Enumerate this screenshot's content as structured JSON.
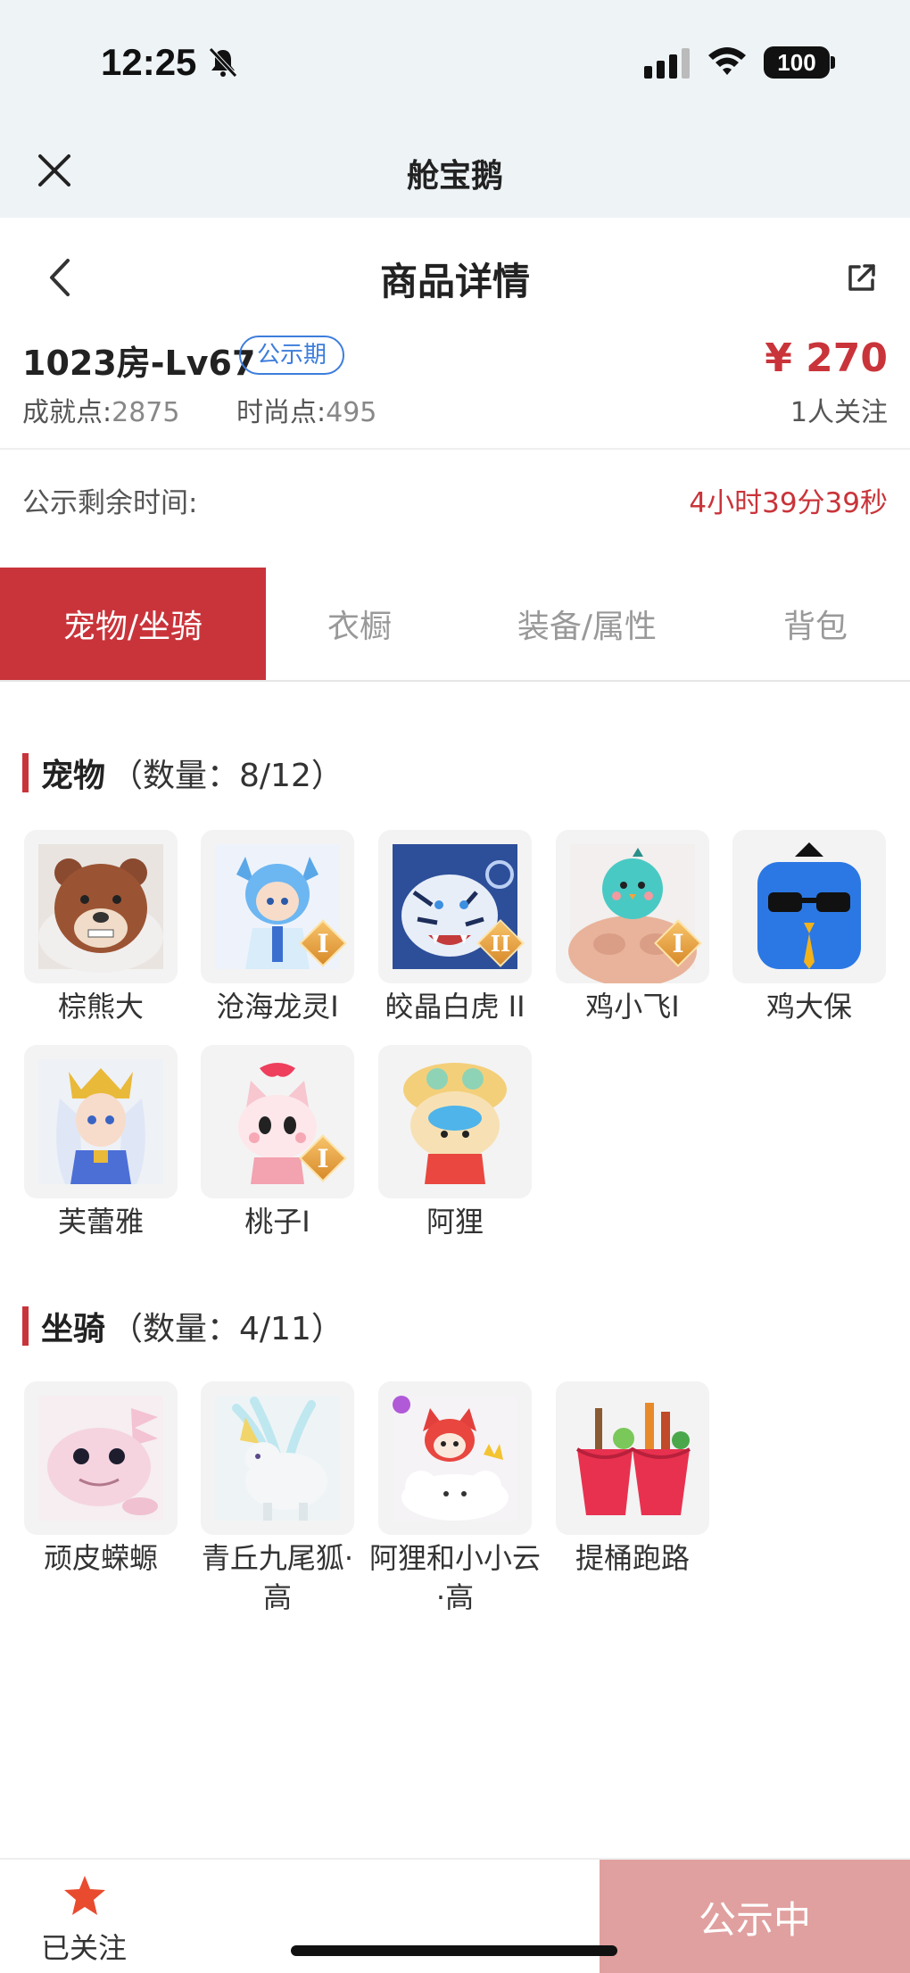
{
  "status_bar": {
    "time": "12:25",
    "battery": "100"
  },
  "app_bar": {
    "title": "舱宝鹅"
  },
  "header": {
    "title": "商品详情"
  },
  "product": {
    "title": "1023房-Lv67",
    "badge": "公示期",
    "price": "¥ 270",
    "achievement_label": "成就点:",
    "achievement_value": "2875",
    "fashion_label": "时尚点:",
    "fashion_value": "495",
    "followers": "1人关注"
  },
  "remaining": {
    "label": "公示剩余时间:",
    "value": "4小时39分39秒"
  },
  "tabs": [
    {
      "label": "宠物/坐骑",
      "active": true
    },
    {
      "label": "衣橱",
      "active": false
    },
    {
      "label": "装备/属性",
      "active": false
    },
    {
      "label": "背包",
      "active": false
    }
  ],
  "pets": {
    "title": "宠物",
    "count": "（数量：8/12）",
    "items": [
      {
        "name": "棕熊大",
        "icon": "brown-bear-icon"
      },
      {
        "name": "沧海龙灵I",
        "icon": "dragon-spirit-icon",
        "rank": "I"
      },
      {
        "name": "皎晶白虎 II",
        "icon": "white-tiger-icon",
        "rank": "II"
      },
      {
        "name": "鸡小飞I",
        "icon": "chick-icon",
        "rank": "I"
      },
      {
        "name": "鸡大保",
        "icon": "chicken-sunglasses-icon"
      },
      {
        "name": "芙蕾雅",
        "icon": "freya-icon"
      },
      {
        "name": "桃子I",
        "icon": "peach-fox-icon",
        "rank": "I"
      },
      {
        "name": "阿狸",
        "icon": "ali-fox-icon"
      }
    ]
  },
  "mounts": {
    "title": "坐骑",
    "count": "（数量：4/11）",
    "items": [
      {
        "name": "顽皮蝾螈",
        "icon": "axolotl-icon"
      },
      {
        "name": "青丘九尾狐·高",
        "icon": "nine-tail-fox-icon"
      },
      {
        "name": "阿狸和小小云·高",
        "icon": "ali-cloud-icon"
      },
      {
        "name": "提桶跑路",
        "icon": "bucket-icon"
      }
    ]
  },
  "bottom": {
    "follow_label": "已关注",
    "action_label": "公示中"
  },
  "colors": {
    "accent": "#c9343a",
    "badge_blue": "#3d7ddb",
    "disabled_button": "#e0a09f"
  }
}
